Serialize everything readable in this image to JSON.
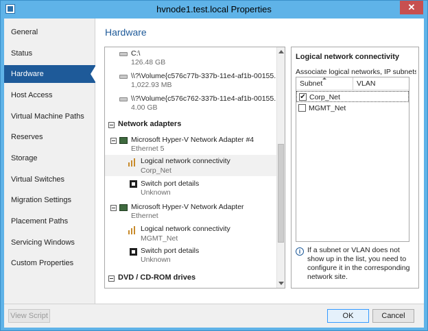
{
  "window": {
    "title": "hvnode1.test.local Properties",
    "close_label": "✕"
  },
  "sidebar": {
    "items": [
      {
        "label": "General"
      },
      {
        "label": "Status"
      },
      {
        "label": "Hardware"
      },
      {
        "label": "Host Access"
      },
      {
        "label": "Virtual Machine Paths"
      },
      {
        "label": "Reserves"
      },
      {
        "label": "Storage"
      },
      {
        "label": "Virtual Switches"
      },
      {
        "label": "Migration Settings"
      },
      {
        "label": "Placement Paths"
      },
      {
        "label": "Servicing Windows"
      },
      {
        "label": "Custom Properties"
      }
    ],
    "selected": "Hardware"
  },
  "page": {
    "title": "Hardware"
  },
  "tree": {
    "drives": [
      {
        "name": "C:\\",
        "size": "126.48 GB"
      },
      {
        "name": "\\\\?\\Volume{c576c77b-337b-11e4-af1b-00155...",
        "size": "1,022.93 MB"
      },
      {
        "name": "\\\\?\\Volume{c576c762-337b-11e4-af1b-00155...",
        "size": "4.00 GB"
      }
    ],
    "network_header": "Network adapters",
    "adapters": [
      {
        "name": "Microsoft Hyper-V Network Adapter #4",
        "sub": "Ethernet 5",
        "lnc_label": "Logical network connectivity",
        "lnc_value": "Corp_Net",
        "port_label": "Switch port details",
        "port_value": "Unknown"
      },
      {
        "name": "Microsoft Hyper-V Network Adapter",
        "sub": "Ethernet",
        "lnc_label": "Logical network connectivity",
        "lnc_value": "MGMT_Net",
        "port_label": "Switch port details",
        "port_value": "Unknown"
      }
    ],
    "dvd_header": "DVD / CD-ROM drives"
  },
  "detail": {
    "title": "Logical network connectivity",
    "description": "Associate logical networks, IP subnets and VLANs",
    "columns": [
      "Subnet",
      "VLAN"
    ],
    "rows": [
      {
        "subnet": "Corp_Net",
        "vlan": "",
        "checked": true
      },
      {
        "subnet": "MGMT_Net",
        "vlan": "",
        "checked": false
      }
    ],
    "info": "If a subnet or VLAN does not show up in the list, you need to configure it in the corresponding network site."
  },
  "footer": {
    "view_script": "View Script",
    "ok": "OK",
    "cancel": "Cancel"
  },
  "colors": {
    "accent": "#1e5a99",
    "titlebar": "#5fb3e8",
    "close": "#c75050"
  }
}
